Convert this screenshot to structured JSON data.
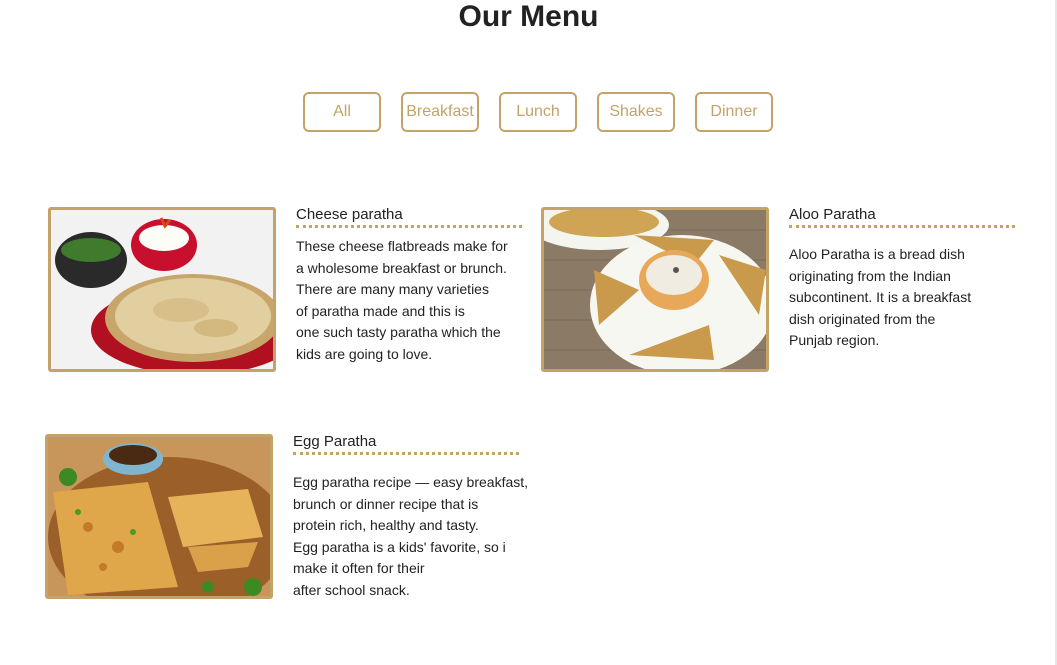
{
  "page": {
    "title": "Our Menu"
  },
  "filters": [
    "All",
    "Breakfast",
    "Lunch",
    "Shakes",
    "Dinner"
  ],
  "items": [
    {
      "name": "Cheese paratha",
      "image_icon": "cheese-paratha-image",
      "description": [
        "These cheese flatbreads make for",
        "a wholesome breakfast or brunch.",
        "There are many many varieties",
        "of paratha made and this is",
        "one such tasty paratha which the",
        "kids are going to love."
      ]
    },
    {
      "name": "Aloo Paratha",
      "image_icon": "aloo-paratha-image",
      "description": [
        "Aloo Paratha is a bread dish",
        "originating from the Indian",
        "subcontinent. It is a breakfast",
        "dish originated from the",
        "Punjab region."
      ]
    },
    {
      "name": "Egg Paratha",
      "image_icon": "egg-paratha-image",
      "description": [
        "Egg paratha recipe — easy breakfast,",
        "brunch or dinner recipe that is",
        "protein rich, healthy and tasty.",
        "Egg paratha is a kids' favorite, so i",
        "make it often for their",
        "after school snack."
      ]
    }
  ],
  "colors": {
    "accent": "#c4a369",
    "text": "#222222",
    "background": "#ffffff"
  }
}
